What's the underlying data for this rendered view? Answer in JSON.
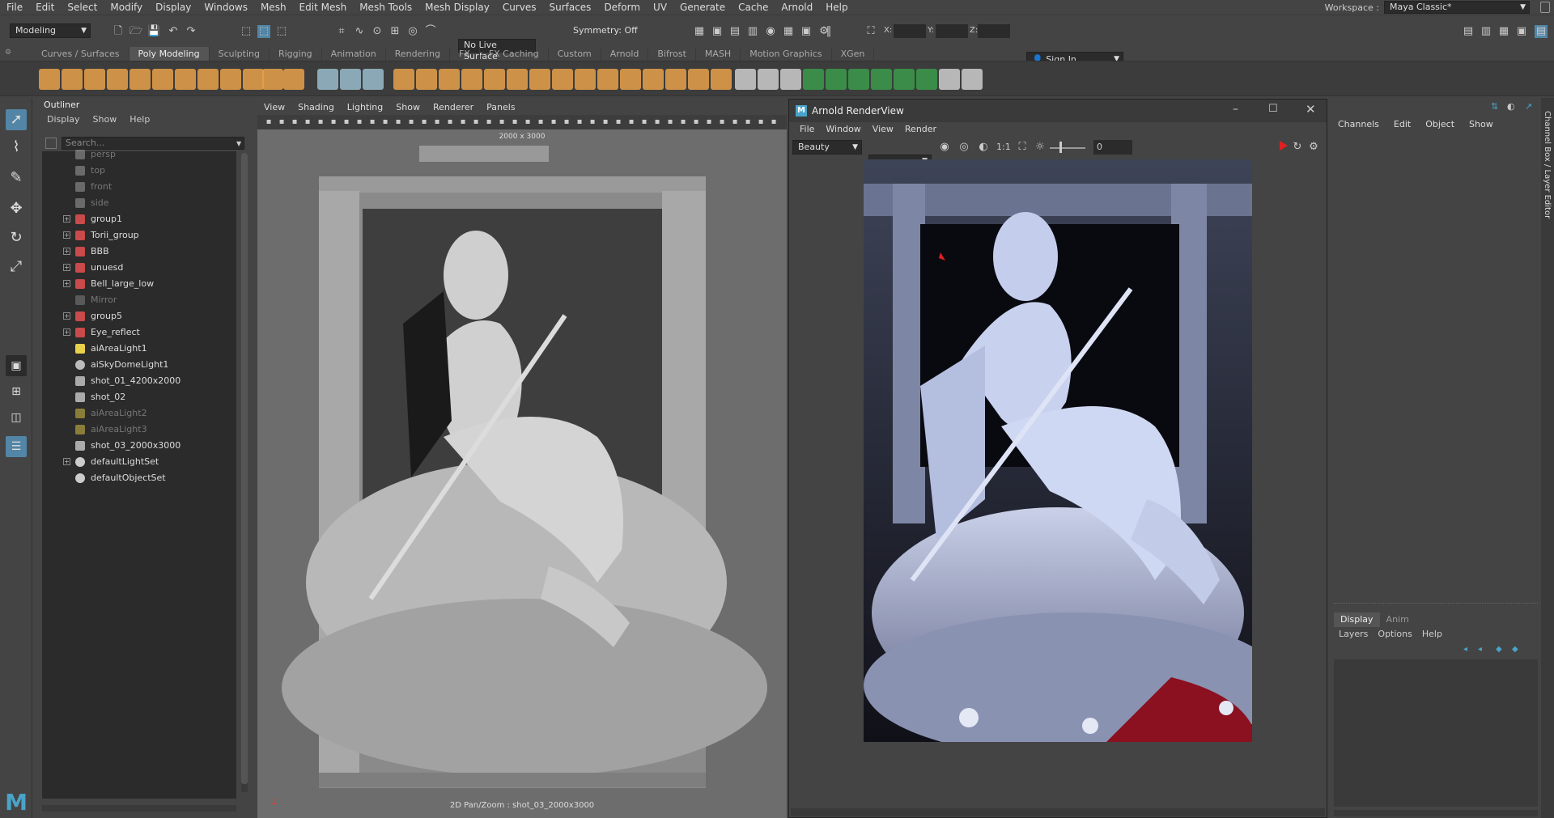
{
  "menu_bar": [
    "File",
    "Edit",
    "Select",
    "Modify",
    "Display",
    "Windows",
    "Mesh",
    "Edit Mesh",
    "Mesh Tools",
    "Mesh Display",
    "Curves",
    "Surfaces",
    "Deform",
    "UV",
    "Generate",
    "Cache",
    "Arnold",
    "Help"
  ],
  "workspace": {
    "label": "Workspace :",
    "value": "Maya Classic*"
  },
  "status_line": {
    "mode": "Modeling",
    "live_surface": "No Live Surface",
    "symmetry": "Symmetry: Off",
    "x_label": "X:",
    "y_label": "Y:",
    "z_label": "Z:",
    "sign_in": "Sign In"
  },
  "shelf_tabs": [
    "Curves / Surfaces",
    "Poly Modeling",
    "Sculpting",
    "Rigging",
    "Animation",
    "Rendering",
    "FX",
    "FX Caching",
    "Custom",
    "Arnold",
    "Bifrost",
    "MASH",
    "Motion Graphics",
    "XGen"
  ],
  "shelf_active_tab": "Poly Modeling",
  "outliner": {
    "title": "Outliner",
    "menu": [
      "Display",
      "Show",
      "Help"
    ],
    "search_placeholder": "Search...",
    "items": [
      {
        "label": "persp",
        "type": "camera",
        "dim": true,
        "expandable": false
      },
      {
        "label": "top",
        "type": "camera",
        "dim": true,
        "expandable": false
      },
      {
        "label": "front",
        "type": "camera",
        "dim": true,
        "expandable": false
      },
      {
        "label": "side",
        "type": "camera",
        "dim": true,
        "expandable": false
      },
      {
        "label": "group1",
        "type": "group",
        "dim": false,
        "expandable": true
      },
      {
        "label": "Torii_group",
        "type": "group",
        "dim": false,
        "expandable": true
      },
      {
        "label": "BBB",
        "type": "group",
        "dim": false,
        "expandable": true
      },
      {
        "label": "unuesd",
        "type": "group",
        "dim": false,
        "expandable": true
      },
      {
        "label": "Bell_large_low",
        "type": "group",
        "dim": false,
        "expandable": true
      },
      {
        "label": "Mirror",
        "type": "mesh",
        "dim": true,
        "expandable": false
      },
      {
        "label": "group5",
        "type": "group",
        "dim": false,
        "expandable": true
      },
      {
        "label": "Eye_reflect",
        "type": "group",
        "dim": false,
        "expandable": true
      },
      {
        "label": "aiAreaLight1",
        "type": "light",
        "dim": false,
        "expandable": false
      },
      {
        "label": "aiSkyDomeLight1",
        "type": "skydome",
        "dim": false,
        "expandable": false
      },
      {
        "label": "shot_01_4200x2000",
        "type": "camera",
        "dim": false,
        "expandable": false
      },
      {
        "label": "shot_02",
        "type": "camera",
        "dim": false,
        "expandable": false
      },
      {
        "label": "aiAreaLight2",
        "type": "light",
        "dim": true,
        "expandable": false
      },
      {
        "label": "aiAreaLight3",
        "type": "light",
        "dim": true,
        "expandable": false
      },
      {
        "label": "shot_03_2000x3000",
        "type": "camera",
        "dim": false,
        "expandable": false
      },
      {
        "label": "defaultLightSet",
        "type": "set",
        "dim": false,
        "expandable": true
      },
      {
        "label": "defaultObjectSet",
        "type": "set",
        "dim": false,
        "expandable": false
      }
    ]
  },
  "viewport": {
    "menu": [
      "View",
      "Shading",
      "Lighting",
      "Show",
      "Renderer",
      "Panels"
    ],
    "resolution_label": "2000 x 3000",
    "hud_label": "2D Pan/Zoom : shot_03_2000x3000"
  },
  "render_view": {
    "title": "Arnold RenderView",
    "menu": [
      "File",
      "Window",
      "View",
      "Render"
    ],
    "aov": "Beauty",
    "ratio": "1:1",
    "exposure": "0"
  },
  "channel_box": {
    "menu": [
      "Channels",
      "Edit",
      "Object",
      "Show"
    ],
    "side_tab": "Channel Box / Layer Editor",
    "layer_tabs": [
      "Display",
      "Anim"
    ],
    "layer_menu": [
      "Layers",
      "Options",
      "Help"
    ]
  },
  "colors": {
    "accent": "#5285a6",
    "selection": "#4b8bbf",
    "render_red": "#e02020"
  }
}
